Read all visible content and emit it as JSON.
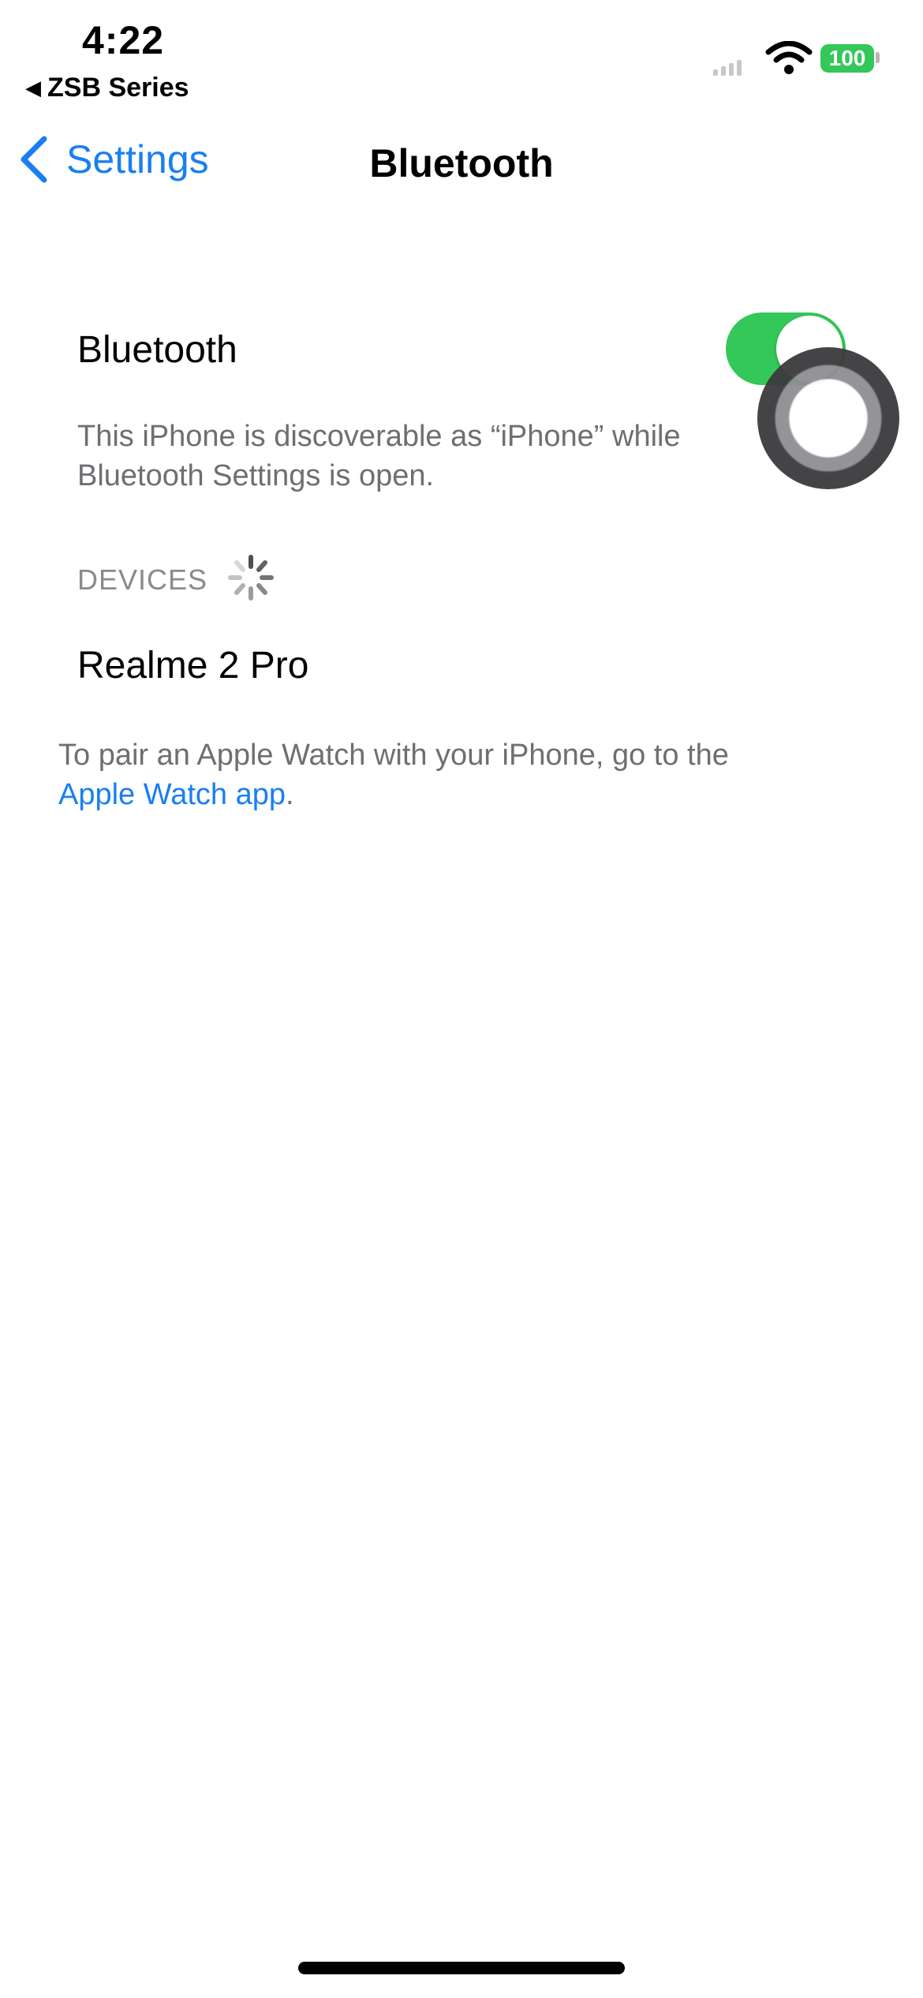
{
  "status_bar": {
    "time": "4:22",
    "back_app": "ZSB Series",
    "battery": "100"
  },
  "nav": {
    "back_label": "Settings",
    "title": "Bluetooth"
  },
  "bluetooth": {
    "label": "Bluetooth",
    "enabled": true,
    "discoverable_text": "This iPhone is discoverable as “iPhone” while Bluetooth Settings is open."
  },
  "devices": {
    "header": "DEVICES",
    "items": [
      {
        "name": "Realme 2 Pro"
      }
    ]
  },
  "pair_note": {
    "text": "To pair an Apple Watch with your iPhone, go to the",
    "link": "Apple Watch app",
    "suffix": "."
  },
  "colors": {
    "accent": "#1a7ff0",
    "toggle_on": "#34c759",
    "secondary_text": "#6e6e73"
  }
}
